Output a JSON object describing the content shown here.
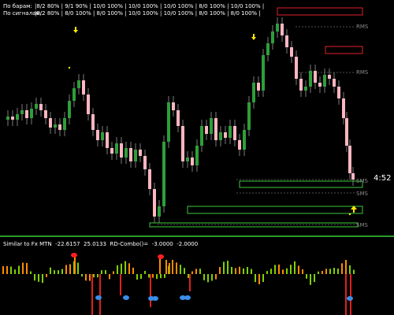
{
  "stats": {
    "by_bars_label": "По барам:",
    "by_bars_values": "|8/2 80% | 9/1 90% | 10/0 100% | 10/0 100% | 10/0 100% | 8/0 100% | 10/0 100% |",
    "by_signals_label": "По сигналам:",
    "by_signals_values": "|8/2 80% | 8/0 100% | 8/0 100% | 10/0 100% | 10/0 100% | 8/0 100% | 8/0 100% |"
  },
  "levels": {
    "level_1": "RMS",
    "level_2": "RMS",
    "level_3": "SMS",
    "level_4": "SMS",
    "level_5": "SMS"
  },
  "current_price": "4:52",
  "indicator": {
    "title": "Similar to Fx MTN  -22.6157  25.0133  RD-Combo()=  -3.0000  -2.0000"
  },
  "colors": {
    "background": "#000000",
    "bull": "#2e9e3a",
    "bear": "#ffb6c1",
    "resistance_box": "#e0202a",
    "support_box": "#3cc83c",
    "arrow": "#ffe600",
    "indicator_green": "#7fd000",
    "indicator_orange": "#ff8c00",
    "indicator_red": "#e02020",
    "dot_blue": "#3a8ee8",
    "dot_red": "#ff2020",
    "separator": "#2a9a2a"
  }
}
